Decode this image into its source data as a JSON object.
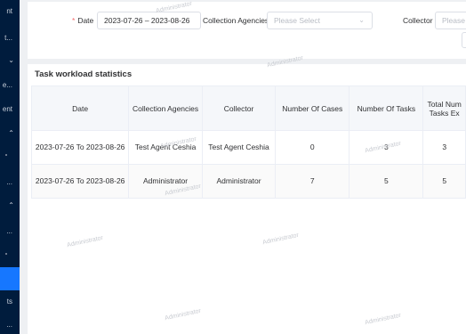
{
  "sidebar": {
    "items": [
      {
        "label": "nt",
        "chevron": "⌄"
      },
      {
        "label": "t...",
        "chevron": "⌄"
      },
      {
        "label": "",
        "chevron": "⌄"
      },
      {
        "label": "e...",
        "chevron": "⌄"
      },
      {
        "label": "ent",
        "chevron": "⌄"
      },
      {
        "label": "",
        "chevron": "⌃"
      },
      {
        "label": "",
        "chevron": ""
      },
      {
        "label": "...",
        "chevron": ""
      },
      {
        "label": "",
        "chevron": "⌃"
      },
      {
        "label": "...",
        "chevron": ""
      },
      {
        "label": "",
        "chevron": ""
      },
      {
        "label": "ts",
        "chevron": ""
      },
      {
        "label": "...",
        "chevron": ""
      }
    ]
  },
  "filters": {
    "date_label": "Date",
    "required_mark": "*",
    "date_value": "2023-07-26 – 2023-08-26",
    "agencies_label": "Collection Agencies",
    "agencies_placeholder": "Please Select",
    "collector_label": "Collector",
    "collector_placeholder": "Please",
    "select_icon": "chevron-down-icon"
  },
  "table": {
    "title": "Task workload statistics",
    "headers": [
      "Date",
      "Collection Agencies",
      "Collector",
      "Number Of Cases",
      "Number Of Tasks",
      "Total Num Tasks Ex"
    ],
    "rows": [
      [
        "2023-07-26 To 2023-08-26",
        "Test Agent Ceshia",
        "Test Agent Ceshia",
        "0",
        "3",
        "3"
      ],
      [
        "2023-07-26 To 2023-08-26",
        "Administrator",
        "Administrator",
        "7",
        "5",
        "5"
      ]
    ]
  },
  "watermark": "Administrator",
  "colors": {
    "sidebar_bg": "#001c3d",
    "sidebar_active": "#1677ff",
    "required": "#f56c6c"
  }
}
